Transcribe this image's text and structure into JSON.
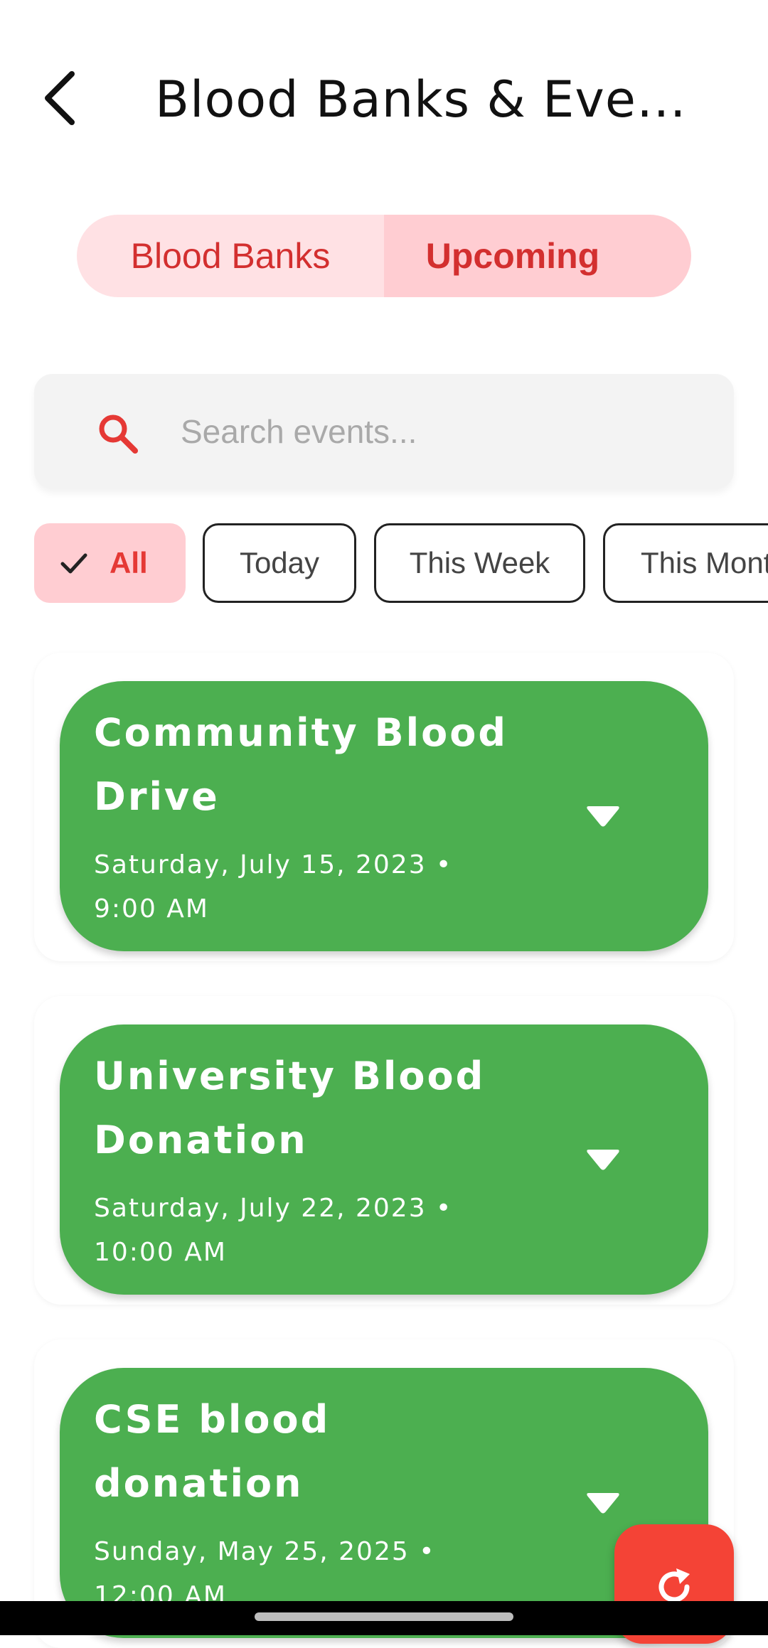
{
  "header": {
    "title": "Blood Banks & Eve…",
    "back_icon": "chevron-left-icon"
  },
  "tabs": [
    {
      "label": "Blood Banks",
      "selected": false
    },
    {
      "label": "Upcoming",
      "selected": true
    }
  ],
  "search": {
    "placeholder": "Search events...",
    "value": "",
    "icon": "search-icon"
  },
  "filters": [
    {
      "label": "All",
      "selected": true
    },
    {
      "label": "Today",
      "selected": false
    },
    {
      "label": "This Week",
      "selected": false
    },
    {
      "label": "This Month",
      "selected": false
    }
  ],
  "events": [
    {
      "title": "Community Blood Drive",
      "datetime": "Saturday, July 15, 2023 • 9:00 AM"
    },
    {
      "title": "University Blood Donation",
      "datetime": "Saturday, July 22, 2023 • 10:00 AM"
    },
    {
      "title": "CSE blood donation",
      "datetime": "Sunday, May 25, 2025 • 12:00 AM"
    }
  ],
  "fab": {
    "icon": "refresh-icon"
  },
  "colors": {
    "accent": "#d32f2f",
    "tab_selected_bg": "#ffcdd2",
    "tab_bg": "#ffe1e4",
    "event_card": "#4caf50",
    "fab": "#f44336"
  }
}
